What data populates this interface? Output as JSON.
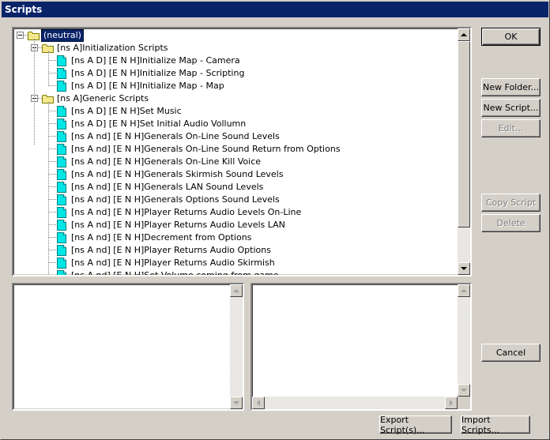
{
  "window": {
    "title": "Scripts"
  },
  "tree": {
    "root": {
      "label": "(neutral)"
    },
    "groups": [
      {
        "label": "[ns A]Initialization Scripts",
        "items": [
          "[ns A D] [E N H]Initialize Map - Camera",
          "[ns A D] [E N H]Initialize Map - Scripting",
          "[ns A D] [E N H]Initialize Map - Map"
        ]
      },
      {
        "label": "[ns A]Generic Scripts",
        "items": [
          "[ns A D] [E N H]Set Music",
          "[ns A D] [E N H]Set Initial Audio Vollumn",
          "[ns A nd] [E N H]Generals On-Line Sound Levels",
          "[ns A nd] [E N H]Generals On-Line Sound Return from Options",
          "[ns A nd] [E N H]Generals On-Line Kill Voice",
          "[ns A nd] [E N H]Generals Skirmish Sound Levels",
          "[ns A nd] [E N H]Generals LAN Sound Levels",
          "[ns A nd] [E N H]Generals Options Sound Levels",
          "[ns A nd] [E N H]Player Returns Audio Levels On-Line",
          "[ns A nd] [E N H]Player Returns Audio Levels LAN",
          "[ns A nd] [E N H]Decrement from Options",
          "[ns A nd] [E N H]Player Returns Audio Options",
          "[ns A nd] [E N H]Player Returns Audio Skirmish",
          "[ns A nd] [E N H]Set Volume coming from game"
        ]
      }
    ]
  },
  "buttons": {
    "ok": "OK",
    "new_folder": "New Folder...",
    "new_script": "New Script...",
    "edit": "Edit...",
    "copy_script": "Copy Script",
    "delete": "Delete",
    "cancel": "Cancel",
    "export": "Export Script(s)...",
    "import": "Import Scripts..."
  },
  "colors": {
    "titlebar": "#0a246a",
    "folder": "#f5e88c",
    "file": "#00e5e5",
    "window_bg": "#d4d0c8"
  }
}
